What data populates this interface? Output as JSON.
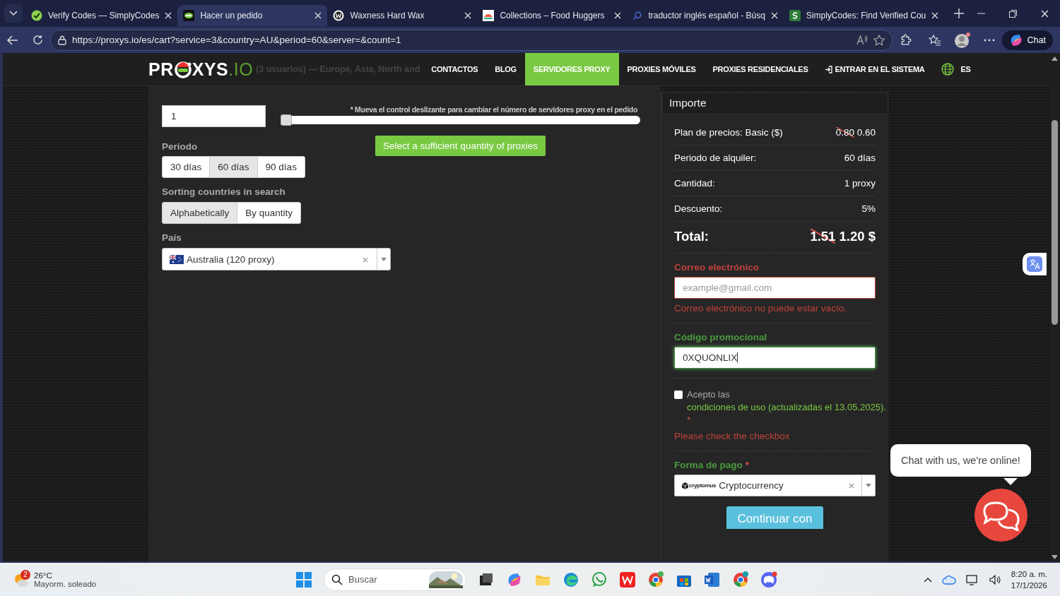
{
  "browser": {
    "tabs": [
      {
        "title": "Verify Codes — SimplyCodes",
        "selected": false
      },
      {
        "title": "Hacer un pedido",
        "selected": true
      },
      {
        "title": "Waxness Hard Wax",
        "selected": false
      },
      {
        "title": "Collections – Food Huggers",
        "selected": false
      },
      {
        "title": "traductor inglés español - Búsq",
        "selected": false
      },
      {
        "title": "SimplyCodes: Find Verified Cou",
        "selected": false
      }
    ],
    "address": "https://proxys.io/es/cart?service=3&country=AU&period=60&server=&count=1",
    "chat_button": "Chat"
  },
  "site": {
    "logo": {
      "before": "PR",
      "after": "XYS",
      "suffix": ".IO"
    },
    "tagline": "(3 usuarios) — Europe, Asia, North and",
    "nav": [
      {
        "label": "CONTACTOS",
        "kind": "link",
        "selected": false
      },
      {
        "label": "BLOG",
        "kind": "link",
        "selected": false
      },
      {
        "label": "SERVIDORES PROXY",
        "kind": "link",
        "selected": true
      },
      {
        "label": "PROXIES MÓVILES",
        "kind": "link",
        "selected": false
      },
      {
        "label": "PROXIES RESIDENCIALES",
        "kind": "link",
        "selected": false
      },
      {
        "label": "ENTRAR EN EL SISTEMA",
        "kind": "login",
        "selected": false
      },
      {
        "label": "ES",
        "kind": "language",
        "selected": false
      }
    ]
  },
  "order_form": {
    "quantity": {
      "value": "1"
    },
    "slider": {
      "hint": "* Mueva el control deslizante para cambiar el número de servidores proxy en el pedido",
      "level": 0
    },
    "quantity_button": "Select a sufficient quantity of proxies",
    "period": {
      "label": "Periodo",
      "options": [
        {
          "label": "30 días",
          "selected": false
        },
        {
          "label": "60 días",
          "selected": true
        },
        {
          "label": "90 días",
          "selected": false
        }
      ]
    },
    "sorting": {
      "label": "Sorting countries in search",
      "options": [
        {
          "label": "Alphabetically",
          "selected": true
        },
        {
          "label": "By quantity",
          "selected": false
        }
      ]
    },
    "country": {
      "label": "País",
      "value": "Australia (120 proxy)"
    }
  },
  "summary": {
    "title": "Importe",
    "rows": [
      {
        "label": "Plan de precios:",
        "plan": "Basic ($)",
        "old_value": "0.80",
        "value": "0.60"
      },
      {
        "label": "Periodo de alquiler:",
        "value": "60 días"
      },
      {
        "label": "Cantidad:",
        "value": "1 proxy"
      },
      {
        "label": "Descuento:",
        "value": "5%"
      }
    ],
    "total": {
      "label": "Total:",
      "old_value": "1.51",
      "value": "1.20 $"
    },
    "email": {
      "label": "Correo electrónico",
      "placeholder": "example@gmail.com",
      "invalid": true,
      "error": "Correo electrónico no puede estar vacío."
    },
    "promo": {
      "label": "Código promocional",
      "value": "0XQUONLIX",
      "invalid": false
    },
    "terms": {
      "checked": false,
      "text": "Acepto las",
      "link": "condiciones de uso (actualizadas el 13.05.2025).",
      "required": "*",
      "error": "Please check the checkbox"
    },
    "payment": {
      "label": "Forma de pago",
      "required": "*",
      "provider": "cryptomus",
      "value": "Cryptocurrency"
    },
    "submit": "Continuar con"
  },
  "chat": {
    "bubble": "Chat with us, we're online!"
  },
  "taskbar": {
    "weather": {
      "badge": "2",
      "temperature": "26°C",
      "condition": "Mayorm. soleado"
    },
    "search_placeholder": "Buscar",
    "time": "8:20 a. m.",
    "date": "17/1/2026"
  }
}
